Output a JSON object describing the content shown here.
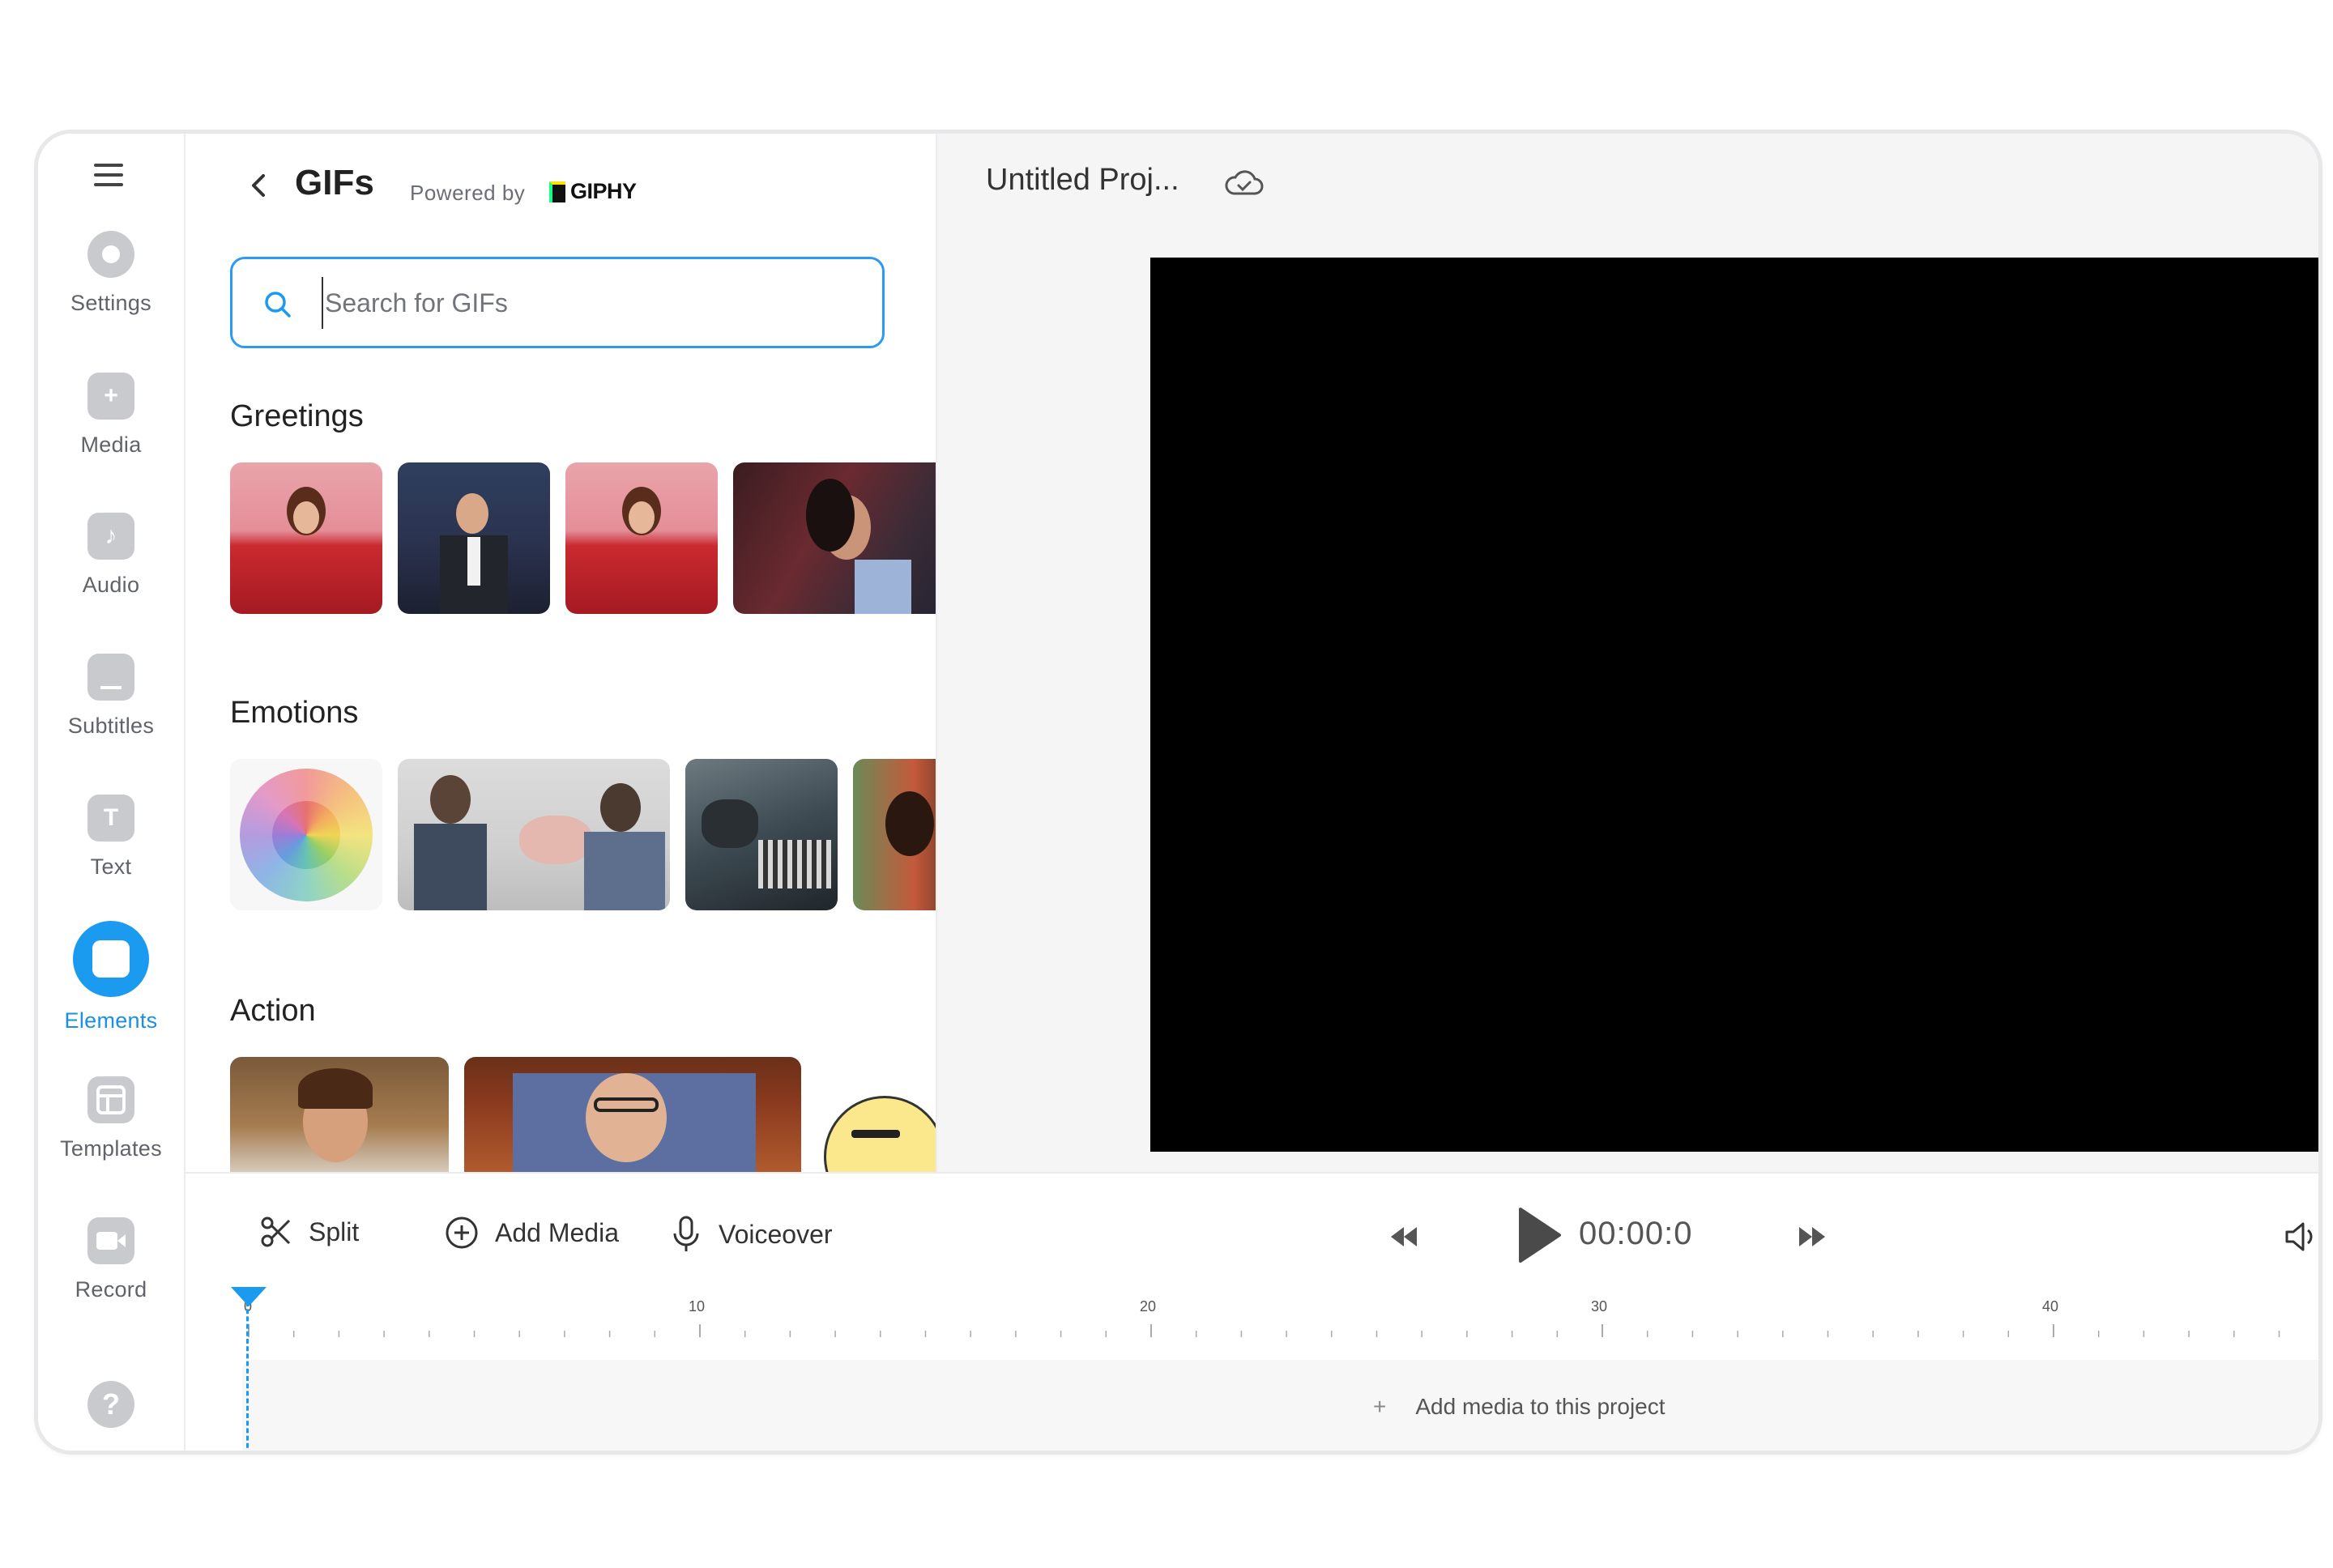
{
  "sidebar": {
    "items": [
      {
        "label": "Settings",
        "icon": "settings-icon"
      },
      {
        "label": "Media",
        "icon": "plus-icon"
      },
      {
        "label": "Audio",
        "icon": "music-note-icon"
      },
      {
        "label": "Subtitles",
        "icon": "subtitles-icon"
      },
      {
        "label": "Text",
        "icon": "text-icon"
      },
      {
        "label": "Elements",
        "icon": "elements-icon",
        "active": true
      },
      {
        "label": "Templates",
        "icon": "templates-icon"
      },
      {
        "label": "Record",
        "icon": "record-icon"
      }
    ],
    "help": "?"
  },
  "panel": {
    "title": "GIFs",
    "powered_by": "Powered by",
    "brand": "GIPHY",
    "search_placeholder": "Search for GIFs",
    "sections": [
      "Greetings",
      "Emotions",
      "Action"
    ]
  },
  "header": {
    "project_title": "Untitled Proj..."
  },
  "toolbar": {
    "split": "Split",
    "add_media": "Add Media",
    "voiceover": "Voiceover",
    "time": "00:00:0",
    "time_suffix": "0"
  },
  "timeline": {
    "ticks": [
      "0",
      "10",
      "20",
      "30",
      "40"
    ],
    "add_media_prompt": "Add media to this project",
    "add_symbol": "+"
  },
  "colors": {
    "accent": "#1a9bf0",
    "icon_gray": "#c9cacd"
  }
}
